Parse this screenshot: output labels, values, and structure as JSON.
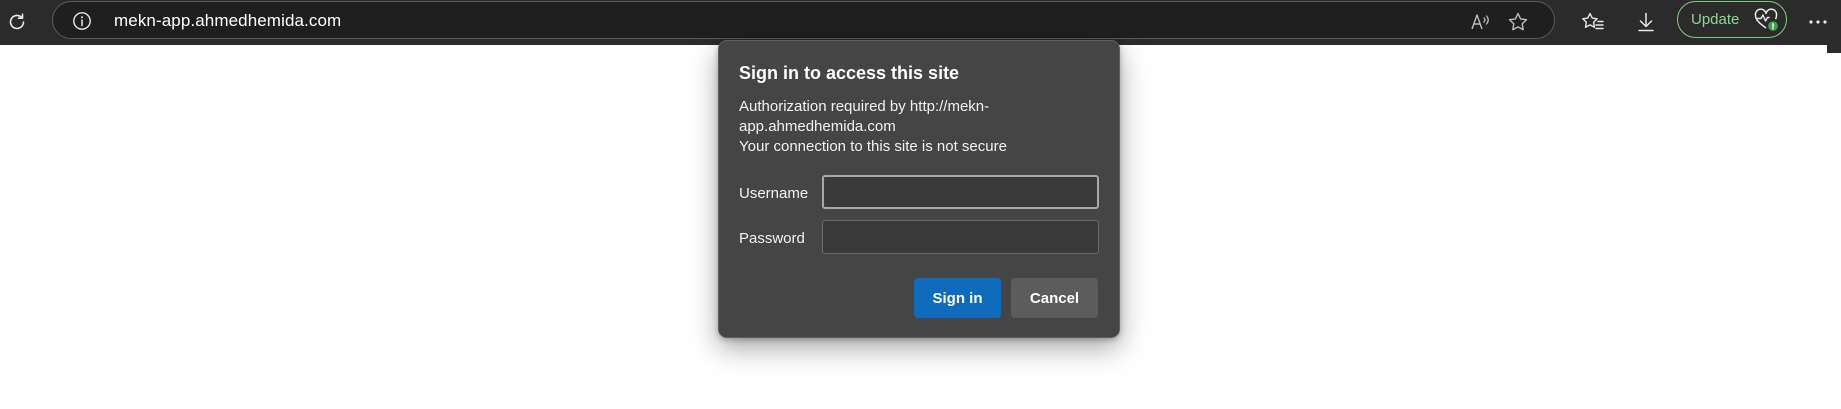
{
  "browser": {
    "url": "mekn-app.ahmedhemida.com",
    "toolbar_icons": {
      "refresh": "refresh-icon",
      "site_info": "info-icon",
      "read_aloud": "read-aloud-icon",
      "favorite": "star-icon",
      "favorites_list": "favorites-icon",
      "downloads": "download-icon",
      "menu": "more-icon"
    },
    "update_label": "Update",
    "update_color": "#8fd88f"
  },
  "dialog": {
    "title": "Sign in to access this site",
    "message_line1": "Authorization required by http://mekn-",
    "message_line2": "app.ahmedhemida.com",
    "message_line3": "Your connection to this site is not secure",
    "username_label": "Username",
    "username_value": "",
    "password_label": "Password",
    "password_value": "",
    "signin_label": "Sign in",
    "cancel_label": "Cancel",
    "primary_color": "#0f6cbd"
  }
}
